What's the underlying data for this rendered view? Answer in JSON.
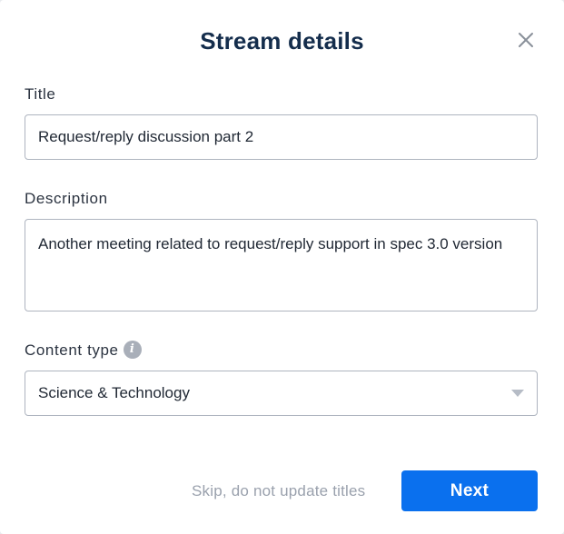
{
  "dialog": {
    "title": "Stream details",
    "close_icon": "close-icon"
  },
  "form": {
    "title_label": "Title",
    "title_value": "Request/reply discussion part 2",
    "description_label": "Description",
    "description_value": "Another meeting related to request/reply support in spec 3.0 version",
    "content_type_label": "Content type",
    "content_type_info_icon": "info-icon",
    "content_type_value": "Science & Technology",
    "content_type_chevron_icon": "chevron-down-icon"
  },
  "footer": {
    "skip_label": "Skip, do not update titles",
    "next_label": "Next"
  },
  "colors": {
    "title": "#142d4c",
    "primary_button": "#0a70ee",
    "muted_text": "#9aa1ad",
    "input_border": "#aeb4bf"
  }
}
